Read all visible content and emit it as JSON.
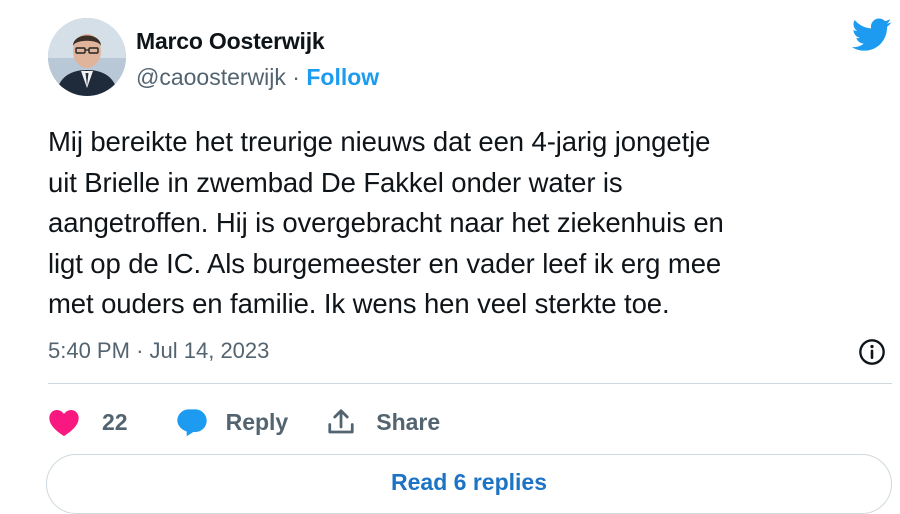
{
  "author": {
    "name": "Marco Oosterwijk",
    "handle": "@caoosterwijk",
    "separator": "·",
    "follow_label": "Follow",
    "avatar_icon": "profile-photo"
  },
  "tweet": {
    "lines": [
      "Mij bereikte het treurige nieuws dat een 4-jarig jongetje",
      "uit Brielle in zwembad De Fakkel onder water is",
      "aangetroffen. Hij is overgebracht naar het ziekenhuis en",
      "ligt op de IC. Als burgemeester en vader leef ik erg mee",
      "met ouders en familie. Ik wens hen veel sterkte toe."
    ],
    "time": "5:40 PM",
    "separator": "·",
    "date": "Jul 14, 2023"
  },
  "actions": {
    "like_count": "22",
    "reply_label": "Reply",
    "share_label": "Share"
  },
  "read_replies_label": "Read 6 replies",
  "colors": {
    "brand_blue": "#1d9bf0",
    "like_pink": "#f91880",
    "reply_blue": "#1d9bf0",
    "secondary_text": "#536471",
    "primary_text": "#0f1419",
    "border": "#cfd9de"
  },
  "icons": {
    "logo": "twitter-bird-icon",
    "info": "info-icon",
    "like": "heart-icon",
    "reply": "reply-bubble-icon",
    "share": "share-upload-icon"
  }
}
